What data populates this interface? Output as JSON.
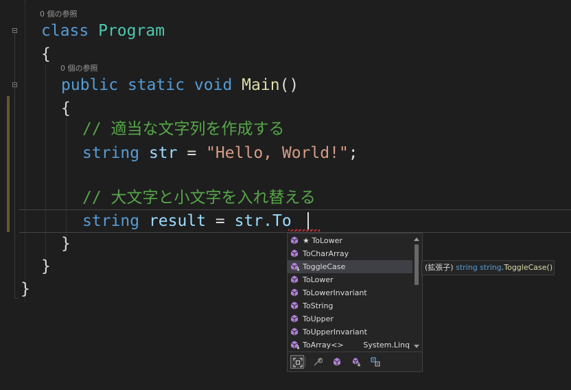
{
  "codelens": {
    "class_refs": "0 個の参照",
    "main_refs": "0 個の参照"
  },
  "code": {
    "kw_class": "class",
    "class_name": "Program",
    "brace_open": "{",
    "brace_close": "}",
    "kw_public": "public",
    "kw_static": "static",
    "kw_void": "void",
    "method_name": "Main",
    "parens": "()",
    "comment1": "// 適当な文字列を作成する",
    "kw_string": "string",
    "var_str": "str",
    "eq": "=",
    "literal": "\"Hello, World!\"",
    "semicolon": ";",
    "comment2": "// 大文字と小文字を入れ替える",
    "var_result": "result",
    "typed_prefix": "str.",
    "typed_member": "To"
  },
  "completion": {
    "items": [
      {
        "label": "★ ToLower",
        "icon": "method-icon",
        "namespace": ""
      },
      {
        "label": "ToCharArray",
        "icon": "method-icon",
        "namespace": ""
      },
      {
        "label": "ToggleCase",
        "icon": "extension-method-icon",
        "namespace": ""
      },
      {
        "label": "ToLower",
        "icon": "method-icon",
        "namespace": ""
      },
      {
        "label": "ToLowerInvariant",
        "icon": "method-icon",
        "namespace": ""
      },
      {
        "label": "ToString",
        "icon": "method-icon",
        "namespace": ""
      },
      {
        "label": "ToUpper",
        "icon": "method-icon",
        "namespace": ""
      },
      {
        "label": "ToUpperInvariant",
        "icon": "method-icon",
        "namespace": ""
      },
      {
        "label": "ToArray<>",
        "icon": "extension-method-icon",
        "namespace": "System.Linq"
      }
    ],
    "selected_index": 2,
    "filters": [
      "expand-snippets-icon",
      "wrench-icon",
      "method-filter-icon",
      "extension-method-filter-icon",
      "target-typed-icon"
    ]
  },
  "tooltip": {
    "prefix": "(拡張子) ",
    "kw1": "string",
    "space": " ",
    "kw2": "string",
    "method": ".ToggleCase()"
  },
  "colors": {
    "background": "#1e1e1e",
    "keyword": "#569cd6",
    "type": "#4ec9b0",
    "method": "#dcdcaa",
    "identifier": "#9cdcfe",
    "string": "#d69d85",
    "comment": "#57a64a",
    "method_icon": "#b180d7"
  }
}
